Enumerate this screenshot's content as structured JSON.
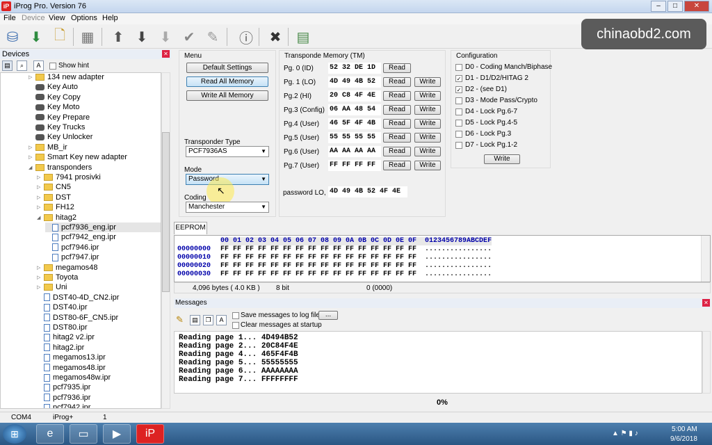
{
  "window": {
    "title": "iProg Pro. Version 76",
    "logo": "iP"
  },
  "menubar": [
    "File",
    "Device",
    "View",
    "Options",
    "Help"
  ],
  "watermark": "chinaobd2.com",
  "devices": {
    "header": "Devices",
    "show_hint": "Show hint",
    "tree": [
      {
        "label": "134 new adapter",
        "icon": "folder",
        "level": 3
      },
      {
        "label": "Key Auto",
        "icon": "car",
        "level": 3
      },
      {
        "label": "Key Copy",
        "icon": "car",
        "level": 3
      },
      {
        "label": "Key Moto",
        "icon": "car",
        "level": 3
      },
      {
        "label": "Key Prepare",
        "icon": "car",
        "level": 3
      },
      {
        "label": "Key Trucks",
        "icon": "car",
        "level": 3
      },
      {
        "label": "Key Unlocker",
        "icon": "car",
        "level": 3
      },
      {
        "label": "MB_ir",
        "icon": "folder",
        "level": 3
      },
      {
        "label": "Smart Key new adapter",
        "icon": "folder",
        "level": 3
      },
      {
        "label": "transponders",
        "icon": "folder",
        "level": 3
      },
      {
        "label": "7941 prosivki",
        "icon": "folder",
        "level": 4
      },
      {
        "label": "CN5",
        "icon": "folder",
        "level": 4
      },
      {
        "label": "DST",
        "icon": "folder",
        "level": 4
      },
      {
        "label": "FH12",
        "icon": "folder",
        "level": 4
      },
      {
        "label": "hitag2",
        "icon": "folder",
        "level": 4
      },
      {
        "label": "pcf7936_eng.ipr",
        "icon": "file",
        "level": 5
      },
      {
        "label": "pcf7942_eng.ipr",
        "icon": "file",
        "level": 5
      },
      {
        "label": "pcf7946.ipr",
        "icon": "file",
        "level": 5
      },
      {
        "label": "pcf7947.ipr",
        "icon": "file",
        "level": 5
      },
      {
        "label": "megamos48",
        "icon": "folder",
        "level": 4
      },
      {
        "label": "Toyota",
        "icon": "folder",
        "level": 4
      },
      {
        "label": "Uni",
        "icon": "folder",
        "level": 4
      },
      {
        "label": "DST40-4D_CN2.ipr",
        "icon": "file",
        "level": 4
      },
      {
        "label": "DST40.ipr",
        "icon": "file",
        "level": 4
      },
      {
        "label": "DST80-6F_CN5.ipr",
        "icon": "file",
        "level": 4
      },
      {
        "label": "DST80.ipr",
        "icon": "file",
        "level": 4
      },
      {
        "label": "hitag2 v2.ipr",
        "icon": "file",
        "level": 4
      },
      {
        "label": "hitag2.ipr",
        "icon": "file",
        "level": 4
      },
      {
        "label": "megamos13.ipr",
        "icon": "file",
        "level": 4
      },
      {
        "label": "megamos48.ipr",
        "icon": "file",
        "level": 4
      },
      {
        "label": "megamos48w.ipr",
        "icon": "file",
        "level": 4
      },
      {
        "label": "pcf7935.ipr",
        "icon": "file",
        "level": 4
      },
      {
        "label": "pcf7936.ipr",
        "icon": "file",
        "level": 4
      },
      {
        "label": "pcf7942.ipr",
        "icon": "file",
        "level": 4
      }
    ]
  },
  "menu": {
    "title": "Menu",
    "default_settings": "Default Settings",
    "read_all": "Read All Memory",
    "write_all": "Write All Memory",
    "transponder_type_label": "Transponder Type",
    "transponder_type": "PCF7936AS",
    "mode_label": "Mode",
    "mode": "Password",
    "coding_label": "Coding",
    "coding": "Manchester"
  },
  "tm": {
    "title": "Transponde Memory (TM)",
    "read": "Read",
    "write": "Write",
    "pages": [
      {
        "label": "Pg. 0 (ID)",
        "value": "52 32 DE 1D",
        "writable": false
      },
      {
        "label": "Pg. 1 (LO)",
        "value": "4D 49 4B 52",
        "writable": true
      },
      {
        "label": "Pg.2 (HI)",
        "value": "20 C8 4F 4E",
        "writable": true
      },
      {
        "label": "Pg.3 (Config)",
        "value": "06 AA 48 54",
        "writable": true
      },
      {
        "label": "Pg.4 (User)",
        "value": "46 5F 4F 4B",
        "writable": true
      },
      {
        "label": "Pg.5 (User)",
        "value": "55 55 55 55",
        "writable": true
      },
      {
        "label": "Pg.6 (User)",
        "value": "AA AA AA AA",
        "writable": true
      },
      {
        "label": "Pg.7 (User)",
        "value": "FF FF FF FF",
        "writable": true
      }
    ],
    "password_label": "password LO, HI",
    "password_value": "4D 49 4B 52 4F 4E"
  },
  "config": {
    "title": "Configuration",
    "write": "Write",
    "items": [
      {
        "label": "D0 - Coding Manch/Biphase",
        "checked": false
      },
      {
        "label": "D1 - D1/D2/HITAG 2",
        "checked": true
      },
      {
        "label": "D2 - (see D1)",
        "checked": true
      },
      {
        "label": "D3 - Mode Pass/Crypto",
        "checked": false
      },
      {
        "label": "D4 - Lock Pg.6-7",
        "checked": false
      },
      {
        "label": "D5 - Lock Pg.4-5",
        "checked": false
      },
      {
        "label": "D6 - Lock Pg.3",
        "checked": false
      },
      {
        "label": "D7 - Lock Pg.1-2",
        "checked": false
      }
    ]
  },
  "eeprom": {
    "tab": "EEPROM",
    "header": "00 01 02 03 04 05 06 07 08 09 0A 0B 0C 0D 0E 0F  0123456789ABCDEF",
    "rows": [
      {
        "addr": "00000000",
        "data": "FF FF FF FF FF FF FF FF FF FF FF FF FF FF FF FF  ................"
      },
      {
        "addr": "00000010",
        "data": "FF FF FF FF FF FF FF FF FF FF FF FF FF FF FF FF  ................"
      },
      {
        "addr": "00000020",
        "data": "FF FF FF FF FF FF FF FF FF FF FF FF FF FF FF FF  ................"
      },
      {
        "addr": "00000030",
        "data": "FF FF FF FF FF FF FF FF FF FF FF FF FF FF FF FF  ................"
      }
    ],
    "size": "4,096 bytes ( 4.0 KB )",
    "bits": "8 bit",
    "position": "0 (0000)"
  },
  "messages": {
    "header": "Messages",
    "save_log": "Save messages to log file",
    "browse": "...",
    "clear_startup": "Clear messages at startup",
    "lines": [
      "Reading page 1... 4D494B52",
      "Reading page 2... 20C84F4E",
      "Reading page 4... 465F4F4B",
      "Reading page 5... 55555555",
      "Reading page 6... AAAAAAAA",
      "Reading page 7... FFFFFFFF"
    ],
    "progress": "0%"
  },
  "statusbar": {
    "port": "COM4",
    "device": "iProg+",
    "count": "1"
  },
  "taskbar": {
    "time": "5:00 AM",
    "date": "9/6/2018"
  }
}
